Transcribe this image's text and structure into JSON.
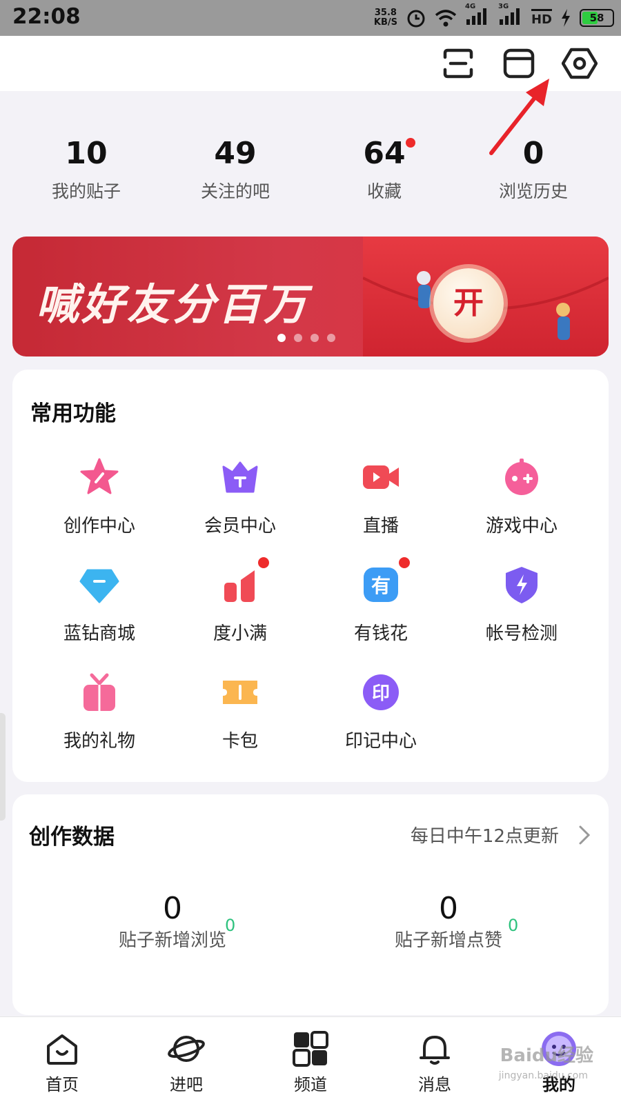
{
  "status_bar": {
    "time": "22:08",
    "net_speed_value": "35.8",
    "net_speed_unit": "KB/S",
    "signal_1": "4G",
    "signal_2": "3G",
    "hd": "HD",
    "battery": "58",
    "battery_level": 0.58
  },
  "stats": [
    {
      "value": "10",
      "label": "我的贴子"
    },
    {
      "value": "49",
      "label": "关注的吧"
    },
    {
      "value": "64",
      "label": "收藏"
    },
    {
      "value": "0",
      "label": "浏览历史"
    }
  ],
  "banner": {
    "text": "喊好友分百万",
    "button": "开",
    "slide_count": 4,
    "active_slide": 1
  },
  "common_functions": {
    "title": "常用功能",
    "items": [
      {
        "label": "创作中心",
        "icon": "star-pen-icon",
        "color": "#f3588f"
      },
      {
        "label": "会员中心",
        "icon": "crown-icon",
        "color": "#8b5cf6"
      },
      {
        "label": "直播",
        "icon": "video-camera-icon",
        "color": "#f04a55"
      },
      {
        "label": "游戏中心",
        "icon": "gamepad-icon",
        "color": "#f55f9a"
      },
      {
        "label": "蓝钻商城",
        "icon": "diamond-icon",
        "color": "#3cb4f0"
      },
      {
        "label": "度小满",
        "icon": "bar-chart-icon",
        "color": "#f04a55"
      },
      {
        "label": "有钱花",
        "icon": "money-icon",
        "color": "#3c9cf5"
      },
      {
        "label": "帐号检测",
        "icon": "shield-bolt-icon",
        "color": "#7c5cf0"
      },
      {
        "label": "我的礼物",
        "icon": "gift-icon",
        "color": "#f56a9a"
      },
      {
        "label": "卡包",
        "icon": "ticket-icon",
        "color": "#fbb650"
      },
      {
        "label": "印记中心",
        "icon": "seal-icon",
        "color": "#8b5cf6",
        "glyph": "印"
      }
    ]
  },
  "creation_data": {
    "title": "创作数据",
    "update_note": "每日中午12点更新",
    "metrics": [
      {
        "value": "0",
        "label": "贴子新增浏览",
        "delta": "0"
      },
      {
        "value": "0",
        "label": "贴子新增点赞",
        "delta": "0"
      }
    ]
  },
  "bottom_nav": [
    {
      "label": "首页",
      "icon": "home-icon"
    },
    {
      "label": "进吧",
      "icon": "planet-icon"
    },
    {
      "label": "频道",
      "icon": "channel-icon"
    },
    {
      "label": "消息",
      "icon": "bell-icon"
    },
    {
      "label": "我的",
      "icon": "avatar-icon",
      "active": true
    }
  ],
  "watermark": {
    "line1": "Baidu经验",
    "line2": "jingyan.baidu.com"
  },
  "colors": {
    "accent_red": "#ee2b2b",
    "banner_red": "#d33848",
    "delta_green": "#2ec27e",
    "annotation_arrow": "#e8232a"
  }
}
